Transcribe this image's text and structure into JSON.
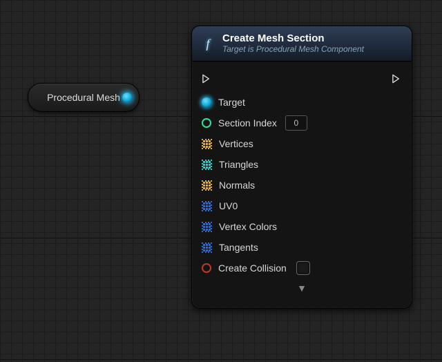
{
  "var_node": {
    "label": "Procedural Mesh"
  },
  "func_node": {
    "title": "Create Mesh Section",
    "subtitle": "Target is Procedural Mesh Component",
    "pins": {
      "target": "Target",
      "section_index": "Section Index",
      "section_index_value": "0",
      "vertices": "Vertices",
      "triangles": "Triangles",
      "normals": "Normals",
      "uv0": "UV0",
      "vertex_colors": "Vertex Colors",
      "tangents": "Tangents",
      "create_collision": "Create Collision"
    },
    "colors": {
      "object": "#17b7e8",
      "int": "#27e69a",
      "vector": "#e0b03a",
      "int_array": "#29d0c7",
      "struct": "#2b6bd9",
      "bool": "#c0392b"
    }
  }
}
